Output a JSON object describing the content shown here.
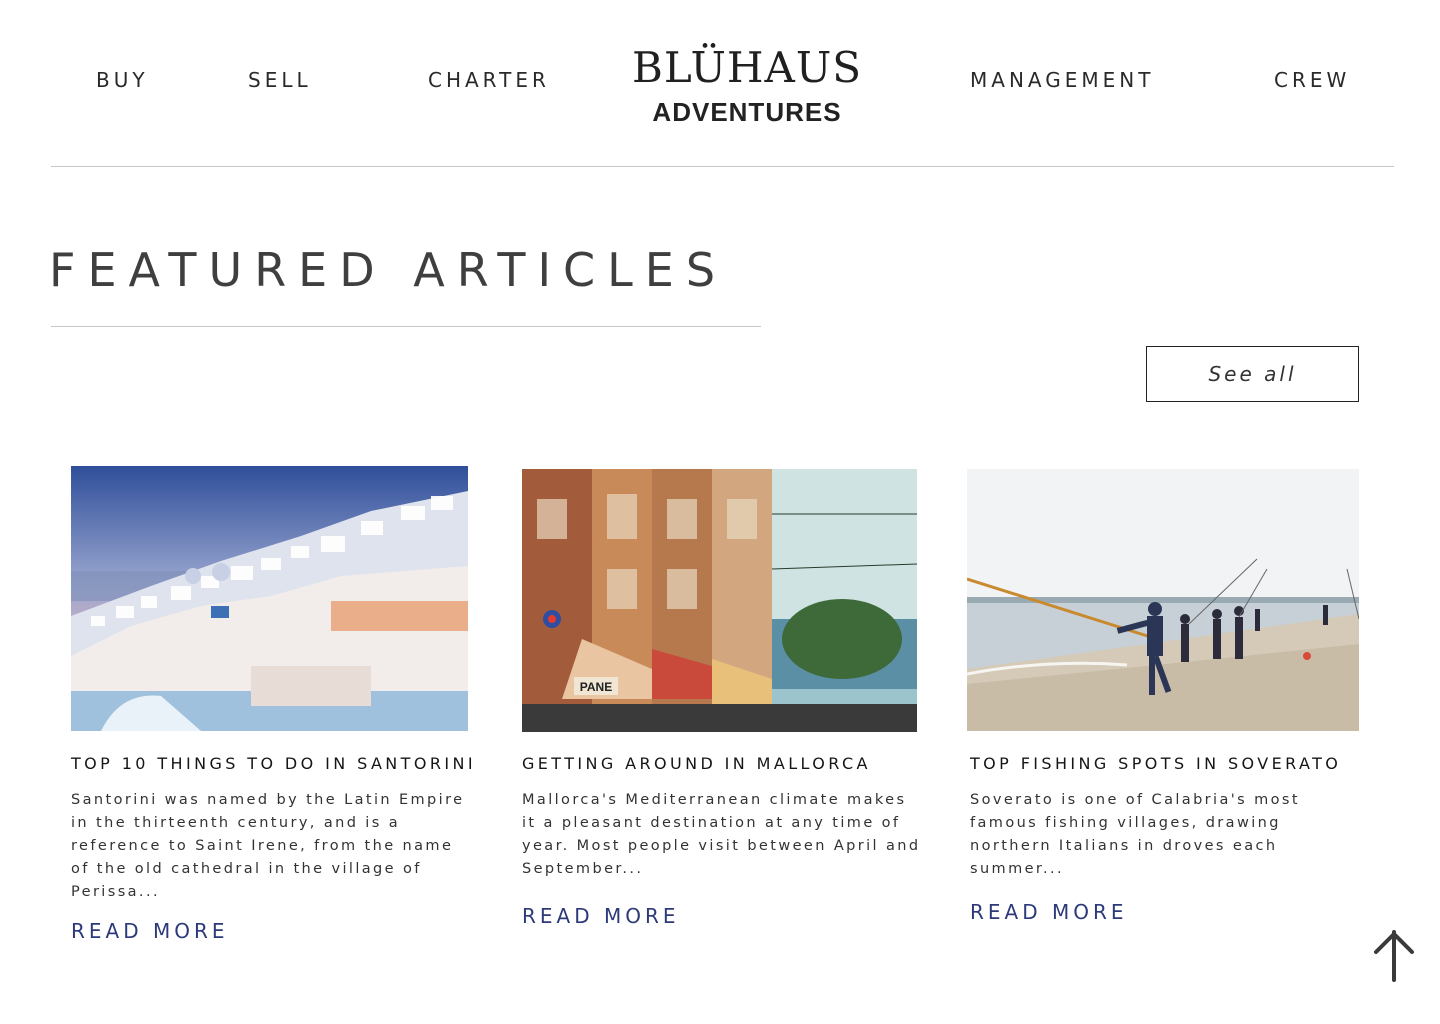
{
  "nav": {
    "buy": "BUY",
    "sell": "SELL",
    "charter": "CHARTER",
    "management": "MANAGEMENT",
    "crew": "CREW"
  },
  "logo": {
    "top": "BLÜHAUS",
    "bottom": "ADVENTURES"
  },
  "featured": {
    "title": "FEATURED ARTICLES",
    "see_all": "See all"
  },
  "articles": [
    {
      "title": "TOP 10 THINGS TO DO IN SANTORINI",
      "excerpt": "Santorini was named by the Latin Empire in the thirteenth century, and is a reference to Saint Irene, from the name of the old cathedral in the village of Perissa...",
      "read_more": "READ MORE",
      "image": "santorini-photo"
    },
    {
      "title": "GETTING AROUND IN MALLORCA",
      "excerpt": "Mallorca's Mediterranean climate makes it a pleasant destination at any time of year. Most people visit between April and September...",
      "read_more": "READ MORE",
      "image": "mallorca-street-photo",
      "sign_text": "PANE"
    },
    {
      "title": "TOP FISHING SPOTS IN  SOVERATO",
      "excerpt": "Soverato is one of Calabria's most famous fishing villages, drawing northern Italians in droves each summer...",
      "read_more": "READ MORE",
      "image": "soverato-fishing-photo"
    }
  ],
  "icons": {
    "back_to_top": "arrow-up-icon"
  },
  "colors": {
    "accent_link": "#2d3a7a",
    "text": "#1f1f1f",
    "divider": "#c8c8c8"
  }
}
